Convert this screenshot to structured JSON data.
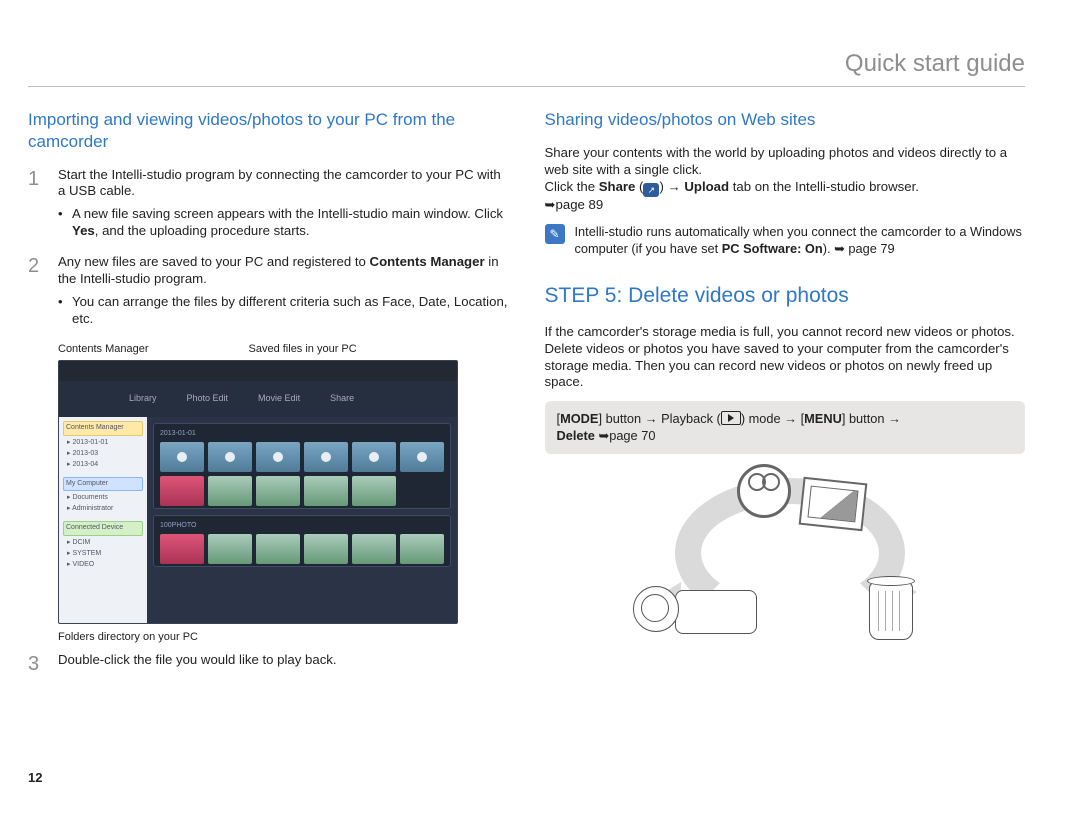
{
  "page_number": "12",
  "header": "Quick start guide",
  "left": {
    "heading": "Importing and viewing videos/photos to your PC from the camcorder",
    "step1": {
      "num": "1",
      "text": "Start the Intelli-studio program by connecting the camcorder to your PC with a USB cable.",
      "bullet_pre": "A new file saving screen appears with the Intelli-studio main window. Click ",
      "bullet_bold": "Yes",
      "bullet_post": ", and the uploading procedure starts."
    },
    "step2": {
      "num": "2",
      "text_pre": "Any new files are saved to your PC and registered to ",
      "text_bold": "Contents Manager",
      "text_post": " in the Intelli-studio program.",
      "bullet": "You can arrange the files by different criteria such as Face, Date, Location, etc."
    },
    "fig_label_left": "Contents Manager",
    "fig_label_right": "Saved files in your PC",
    "toolbar": {
      "a": "Library",
      "b": "Photo Edit",
      "c": "Movie Edit",
      "d": "Share"
    },
    "fig_caption_bottom": "Folders directory on your PC",
    "step3": {
      "num": "3",
      "text": "Double-click the file you would like to play back."
    }
  },
  "right": {
    "share_heading": "Sharing videos/photos on Web sites",
    "share_p1": "Share your contents with the world by uploading photos and videos directly to a web site with a single click.",
    "share_p2_a": "Click the ",
    "share_p2_b": "Share",
    "share_p2_c": " (",
    "share_p2_d": ") ",
    "share_p2_e": "→",
    "share_p2_f": " Upload",
    "share_p2_g": " tab on the Intelli-studio browser. ",
    "share_p2_h": "➥page 89",
    "note_a": "Intelli-studio runs automatically when you connect the camcorder to a Windows computer (if you have set ",
    "note_b": "PC Software: On",
    "note_c": "). ",
    "note_d": "➥",
    "note_e": " page 79",
    "step5_heading": "STEP 5: Delete videos or photos",
    "step5_body": "If the camcorder's storage media is full, you cannot record new videos or photos. Delete videos or photos you have saved to your computer from the camcorder's storage media. Then you can record new videos or photos on newly freed up space.",
    "mode_a": "[",
    "mode_b": "MODE",
    "mode_c": "] button ",
    "mode_d": "→",
    "mode_e": " Playback (",
    "mode_f": ") mode ",
    "mode_g": "→",
    "mode_h": " [",
    "mode_i": "MENU",
    "mode_j": "] button ",
    "mode_k": "→",
    "mode_l": " Delete ",
    "mode_m": "➥",
    "mode_n": "page 70"
  }
}
